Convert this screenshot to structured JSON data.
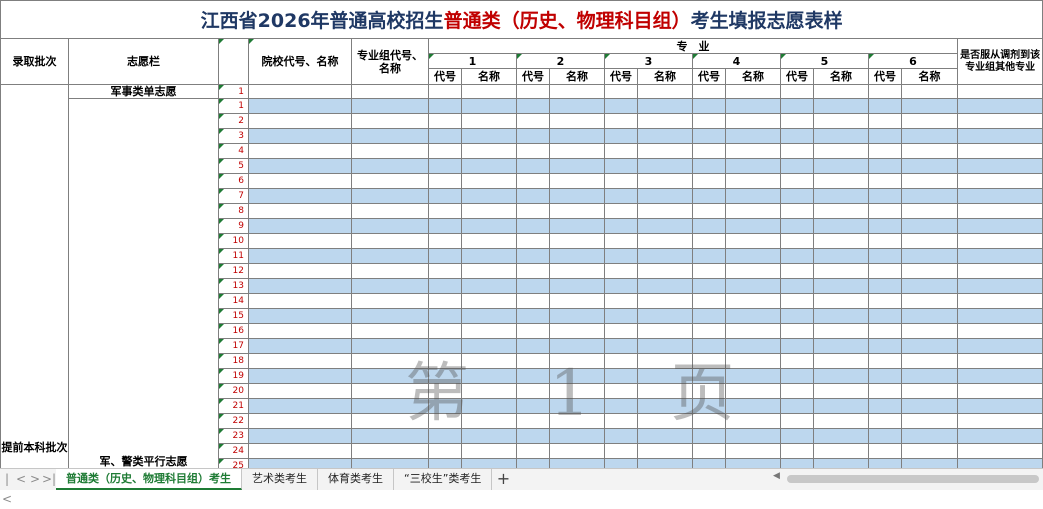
{
  "title": {
    "part1": "江西省2026年普通高校招生",
    "part2": "普通类（历史、物理科目组）",
    "part3": "考生填报志愿表样"
  },
  "headers": {
    "batch": "录取批次",
    "volunteer_col": "志愿栏",
    "school": "院校代号、名称",
    "group": "专业组代号、名称",
    "major": "专　业",
    "major_numbers": [
      "1",
      "2",
      "3",
      "4",
      "5",
      "6"
    ],
    "code": "代号",
    "name": "名称",
    "adjust": "是否服从调剂到该专业组其他专业"
  },
  "rows": {
    "military_single": "军事类单志愿",
    "military_single_index": "1",
    "parallel_label": "军、警类平行志愿",
    "batch_label": "提前本科批次",
    "parallel_numbers": [
      "1",
      "2",
      "3",
      "4",
      "5",
      "6",
      "7",
      "8",
      "9",
      "10",
      "11",
      "12",
      "13",
      "14",
      "15",
      "16",
      "17",
      "18",
      "19",
      "20",
      "21",
      "22",
      "23",
      "24",
      "25"
    ]
  },
  "watermark": "第 1 页",
  "tabs": [
    {
      "label": "普通类（历史、物理科目组）考生",
      "active": true
    },
    {
      "label": "艺术类考生",
      "active": false
    },
    {
      "label": "体育类考生",
      "active": false
    },
    {
      "label": "“三校生”类考生",
      "active": false
    }
  ],
  "tab_nav": {
    "first": "|<",
    "prev": "<",
    "next": ">",
    "last": ">|",
    "add": "+"
  },
  "colors": {
    "row_blue": "#bdd7ee",
    "title_blue": "#1f3864",
    "title_red": "#c00000",
    "index_red": "#c00000",
    "active_tab": "#1e7b34"
  }
}
